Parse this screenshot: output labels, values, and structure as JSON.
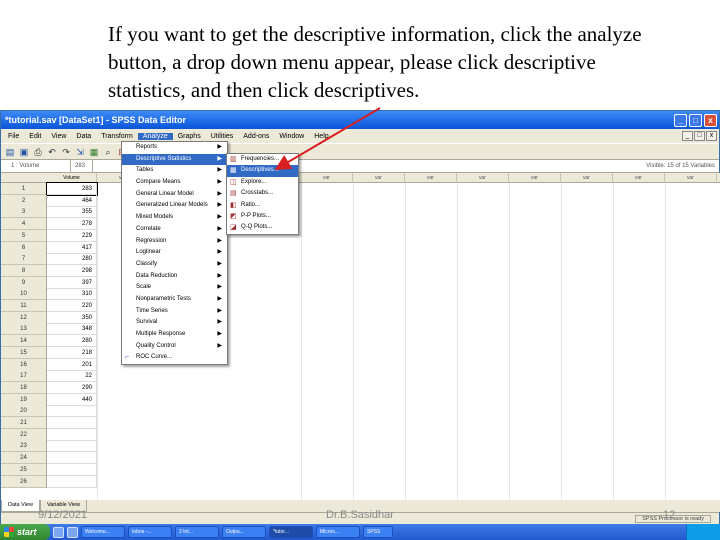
{
  "caption": {
    "line1": "If you want to get the descriptive information, click the analyze",
    "line2": "button, a drop down menu appear, please click descriptive",
    "line3": "statistics, and then click descriptives."
  },
  "window": {
    "title": "*tutorial.sav [DataSet1] - SPSS Data Editor",
    "minimize": "_",
    "maximize": "□",
    "close": "x"
  },
  "menubar": {
    "items": [
      "File",
      "Edit",
      "View",
      "Data",
      "Transform",
      "Analyze",
      "Graphs",
      "Utilities",
      "Add-ons",
      "Window",
      "Help"
    ]
  },
  "toolbar": {
    "icons": [
      "open-icon",
      "save-icon",
      "print-icon",
      "undo-icon",
      "redo-icon",
      "goto-case-icon",
      "variables-icon",
      "find-icon",
      "insert-cases-icon",
      "insert-variable-icon",
      "split-file-icon",
      "weight-cases-icon",
      "select-cases-icon",
      "value-labels-icon",
      "use-sets-icon"
    ]
  },
  "cellbar": {
    "ref": "1 : Volume",
    "value": "283",
    "visible": "Visible: 15 of 15 Variables"
  },
  "grid": {
    "column_header": "Volume",
    "var_header": "var",
    "rows": [
      {
        "n": "1",
        "v": "283"
      },
      {
        "n": "2",
        "v": "464"
      },
      {
        "n": "3",
        "v": "355"
      },
      {
        "n": "4",
        "v": "278"
      },
      {
        "n": "5",
        "v": "229"
      },
      {
        "n": "6",
        "v": "417"
      },
      {
        "n": "7",
        "v": "280"
      },
      {
        "n": "8",
        "v": "298"
      },
      {
        "n": "9",
        "v": "397"
      },
      {
        "n": "10",
        "v": "310"
      },
      {
        "n": "11",
        "v": "220"
      },
      {
        "n": "12",
        "v": "350"
      },
      {
        "n": "13",
        "v": "348"
      },
      {
        "n": "14",
        "v": "280"
      },
      {
        "n": "15",
        "v": "218"
      },
      {
        "n": "16",
        "v": "201"
      },
      {
        "n": "17",
        "v": "22"
      },
      {
        "n": "18",
        "v": "290"
      },
      {
        "n": "19",
        "v": "440"
      },
      {
        "n": "20",
        "v": ""
      },
      {
        "n": "21",
        "v": ""
      },
      {
        "n": "22",
        "v": ""
      },
      {
        "n": "23",
        "v": ""
      },
      {
        "n": "24",
        "v": ""
      },
      {
        "n": "25",
        "v": ""
      },
      {
        "n": "26",
        "v": ""
      }
    ]
  },
  "analyze_menu": {
    "items": [
      {
        "label": "Reports",
        "arrow": "▶"
      },
      {
        "label": "Descriptive Statistics",
        "arrow": "▶"
      },
      {
        "label": "Tables",
        "arrow": "▶"
      },
      {
        "label": "Compare Means",
        "arrow": "▶"
      },
      {
        "label": "General Linear Model",
        "arrow": "▶"
      },
      {
        "label": "Generalized Linear Models",
        "arrow": "▶"
      },
      {
        "label": "Mixed Models",
        "arrow": "▶"
      },
      {
        "label": "Correlate",
        "arrow": "▶"
      },
      {
        "label": "Regression",
        "arrow": "▶"
      },
      {
        "label": "Loglinear",
        "arrow": "▶"
      },
      {
        "label": "Classify",
        "arrow": "▶"
      },
      {
        "label": "Data Reduction",
        "arrow": "▶"
      },
      {
        "label": "Scale",
        "arrow": "▶"
      },
      {
        "label": "Nonparametric Tests",
        "arrow": "▶"
      },
      {
        "label": "Time Series",
        "arrow": "▶"
      },
      {
        "label": "Survival",
        "arrow": "▶"
      },
      {
        "label": "Multiple Response",
        "arrow": "▶"
      },
      {
        "label": "Quality Control",
        "arrow": "▶"
      },
      {
        "label": "ROC Curve...",
        "arrow": ""
      }
    ]
  },
  "descriptive_submenu": {
    "items": [
      {
        "label": "Frequencies...",
        "icon": "frequencies-icon"
      },
      {
        "label": "Descriptives...",
        "icon": "descriptives-icon"
      },
      {
        "label": "Explore...",
        "icon": "explore-icon"
      },
      {
        "label": "Crosstabs...",
        "icon": "crosstabs-icon"
      },
      {
        "label": "Ratio...",
        "icon": "ratio-icon"
      },
      {
        "label": "P-P Plots...",
        "icon": "pp-plots-icon"
      },
      {
        "label": "Q-Q Plots...",
        "icon": "qq-plots-icon"
      }
    ]
  },
  "tabs": {
    "data_view": "Data View",
    "variable_view": "Variable View"
  },
  "status": {
    "processor": "SPSS Processor is ready"
  },
  "taskbar": {
    "start": "start",
    "buttons": [
      "Welcome...",
      "Inbox -...",
      "2 Int...",
      "Outpu...",
      "*tutor...",
      "Micros...",
      "SPSS"
    ]
  },
  "footer": {
    "date": "9/12/2021",
    "author": "Dr.B.Sasidhar",
    "page": "12"
  },
  "colors": {
    "selection": "#316ac5",
    "arrow": "#d81f1f",
    "titlebar": "#0a55d8"
  }
}
